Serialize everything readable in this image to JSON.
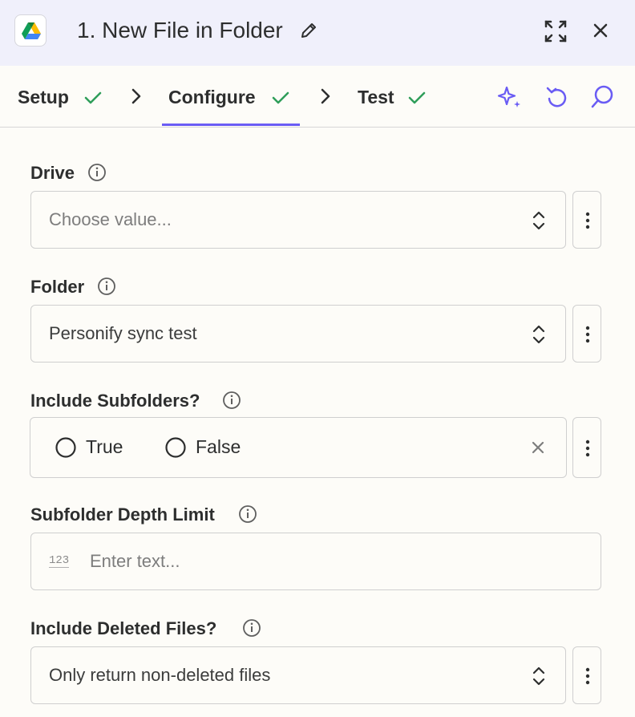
{
  "header": {
    "app_icon": "google-drive-icon",
    "title": "1. New File in Folder"
  },
  "tabs": [
    {
      "label": "Setup",
      "status": "complete"
    },
    {
      "label": "Configure",
      "status": "complete",
      "active": true
    },
    {
      "label": "Test",
      "status": "complete"
    }
  ],
  "toolbar_icons": [
    "sparkle-icon",
    "undo-icon",
    "comment-search-icon"
  ],
  "colors": {
    "accent": "#6a5cf4",
    "check": "#2f9e5a",
    "header_bg": "#f0f0fb"
  },
  "fields": {
    "drive": {
      "label": "Drive",
      "placeholder": "Choose value..."
    },
    "folder": {
      "label": "Folder",
      "value": "Personify sync test"
    },
    "include_subfolders": {
      "label": "Include Subfolders?",
      "options": [
        "True",
        "False"
      ]
    },
    "depth_limit": {
      "label": "Subfolder Depth Limit",
      "type_icon": "123",
      "placeholder": "Enter text..."
    },
    "include_deleted": {
      "label": "Include Deleted Files?",
      "value": "Only return non-deleted files"
    }
  }
}
